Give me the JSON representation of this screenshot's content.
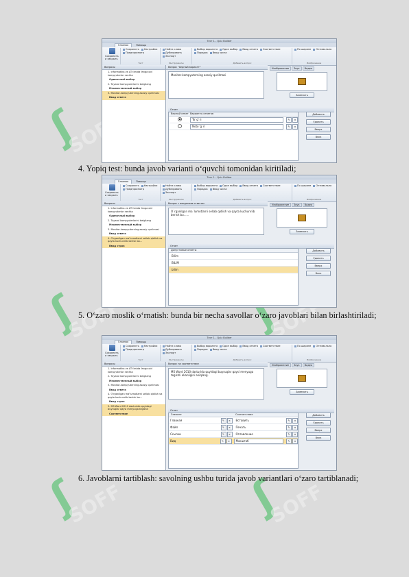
{
  "app": {
    "title": "Тест 1 - Quiz Builder",
    "tabs": [
      "Главная",
      "Помощь"
    ],
    "ribbon": {
      "save_label": "Сохранить и закрыть",
      "groups": [
        {
          "label": "Тест",
          "items": [
            "Сохранить",
            "Настройки",
            "Предпросмотр"
          ]
        },
        {
          "label": "Инструменты",
          "items": [
            "Найти слово",
            "Дублировать",
            "Экспорт"
          ]
        },
        {
          "label": "Добавить вопрос",
          "items": [
            "Выбор варианта",
            "Один выбор",
            "Ввод ответа",
            "Соответствие",
            "Порядок",
            "Ввод числа",
            "Облак слов",
            "Ответ-часть",
            "Эссе",
            "Опрос"
          ]
        },
        {
          "label": "Изображение",
          "items": [
            "По ширине",
            "Оптимально"
          ]
        }
      ],
      "extra_button": "Вопрос вверх"
    },
    "left_header": "Вопросы",
    "questions": [
      {
        "text": "1. Informatika va AT fanida fanga oid kompyuterlar nechta",
        "type": "Одиночный выбор"
      },
      {
        "text": "2. Tuyarol kompyuterlarini belgilang",
        "type": "Множественный выбор"
      },
      {
        "text": "3. Monitor-kompyuterning asosiy qurilmasi",
        "type": "Ввод ответа"
      },
      {
        "text": "4. O'rganilgan ma'lumotlarni sellab qidiish va qayta kuchunriib berish bo...",
        "type": "Ввод строк"
      },
      {
        "text": "5. MS Word 2010 dasturida quyidagi buyruqlar qaysi menyuga tegishli",
        "type": "Соответствие"
      }
    ],
    "image_tabs": [
      "Изображение",
      "Звук",
      "Видео"
    ],
    "image_button": "Заменить",
    "answer_header": "Ответ",
    "side_buttons": [
      "Добавить",
      "Удалить",
      "Вверх",
      "Вниз"
    ]
  },
  "shot1": {
    "question_header": "Вопрос \"верный вариант\"",
    "question_text": "Monitor-kompyuterning asosiy qurilmasi",
    "col_correct": "Верный ответ",
    "col_variants": "Варианты ответов",
    "answers": [
      "To`g`ri",
      "Noto`g`ri"
    ]
  },
  "caption4": "4. Yopiq test: bunda javob varianti o‘quvchi tomonidan kiritiladi;",
  "shot2": {
    "question_header": "Вопрос с вводимым ответом",
    "question_text": "O`rganilgan ma`lumotlarni sellab qidiish va qayta kuchunriib berish bu......",
    "col_answers": "Допустимые ответы",
    "answers": [
      "Bilim",
      "BILIM",
      "bilim"
    ]
  },
  "caption5": "5. O‘zaro moslik o‘rnatish: bunda bir necha savollar o‘zaro javoblari bilan birlashtiriladi;",
  "shot3": {
    "question_header": "Вопрос на соответствие",
    "question_text": "MS Word 2010 dasturida quyidagi buyruqlar qaysi menyuga tegishli ekanligini aniqlang.",
    "col_left": "Элемент",
    "col_right": "Соответствие",
    "pairs": [
      {
        "left": "Главная",
        "right": "Вставить"
      },
      {
        "left": "Файл",
        "right": "Печать"
      },
      {
        "left": "Ссылки",
        "right": "Оглавление"
      },
      {
        "left": "Вид",
        "right": "Масштаб"
      }
    ]
  },
  "caption6": "6. Javoblarni tartiblash: savolning ushbu turida javob variantlari o‘zaro tartiblanadi;",
  "watermark": "SOFF"
}
